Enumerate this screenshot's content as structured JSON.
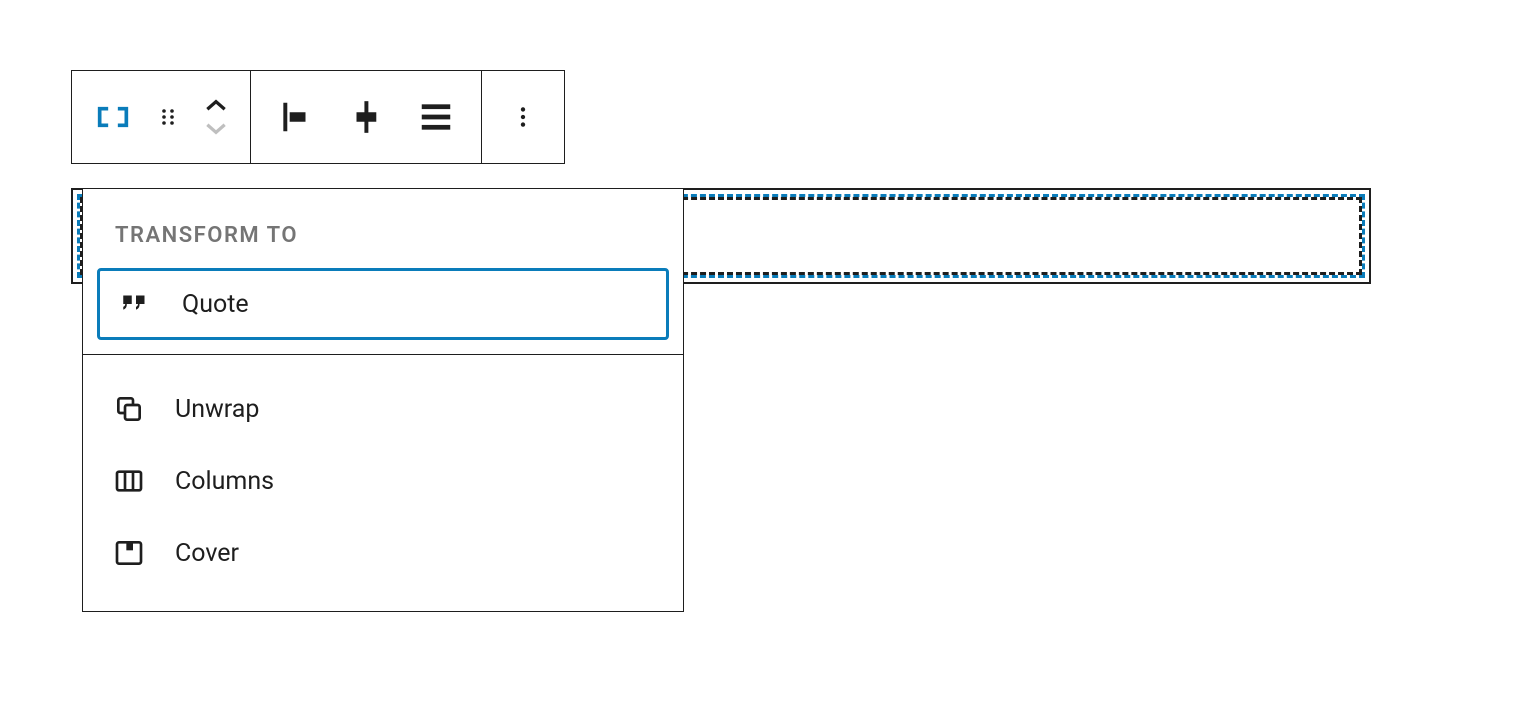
{
  "colors": {
    "accent": "#0a7cba",
    "text": "#1e1e1e",
    "muted": "#757575"
  },
  "toolbar": {
    "groups": [
      {
        "name": "block-type",
        "buttons": [
          "row-icon",
          "drag-handle-icon",
          "mover"
        ]
      },
      {
        "name": "alignment",
        "buttons": [
          "align-left-icon",
          "align-center-icon",
          "justify-icon"
        ]
      },
      {
        "name": "more",
        "buttons": [
          "more-options-icon"
        ]
      }
    ]
  },
  "popover": {
    "heading": "TRANSFORM TO",
    "primary": [
      {
        "icon": "quote-icon",
        "label": "Quote"
      }
    ],
    "secondary": [
      {
        "icon": "unwrap-icon",
        "label": "Unwrap"
      },
      {
        "icon": "columns-icon",
        "label": "Columns"
      },
      {
        "icon": "cover-icon",
        "label": "Cover"
      }
    ]
  }
}
